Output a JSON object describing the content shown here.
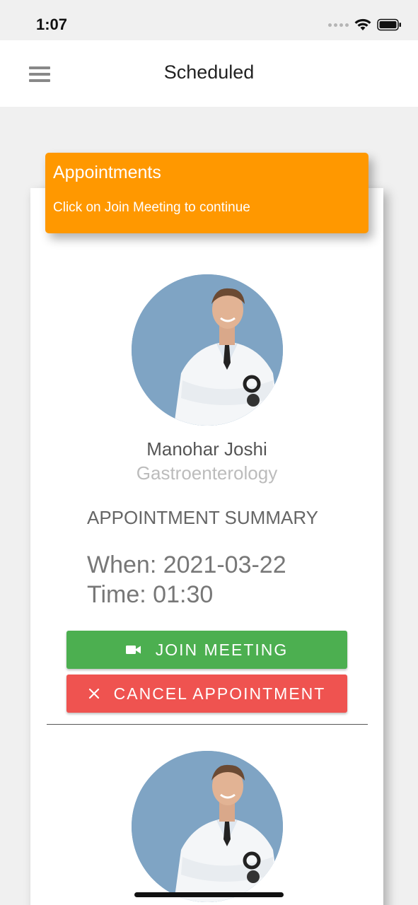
{
  "status_bar": {
    "time": "1:07"
  },
  "header": {
    "title": "Scheduled",
    "menu_icon": "hamburger-menu-icon"
  },
  "banner": {
    "title": "Appointments",
    "subtitle": "Click on Join Meeting to continue",
    "color": "#ff9800"
  },
  "appointments": [
    {
      "doctor_name": "Manohar Joshi",
      "specialty": "Gastroenterology",
      "summary_title": "APPOINTMENT SUMMARY",
      "when": "When: 2021-03-22",
      "time": "Time: 01:30",
      "join_label": "JOIN MEETING",
      "cancel_label": "CANCEL APPOINTMENT"
    }
  ],
  "colors": {
    "join": "#4caf50",
    "cancel": "#ef5350",
    "accent": "#ff9800"
  },
  "icons": {
    "join": "video-camera-icon",
    "cancel": "close-icon"
  }
}
